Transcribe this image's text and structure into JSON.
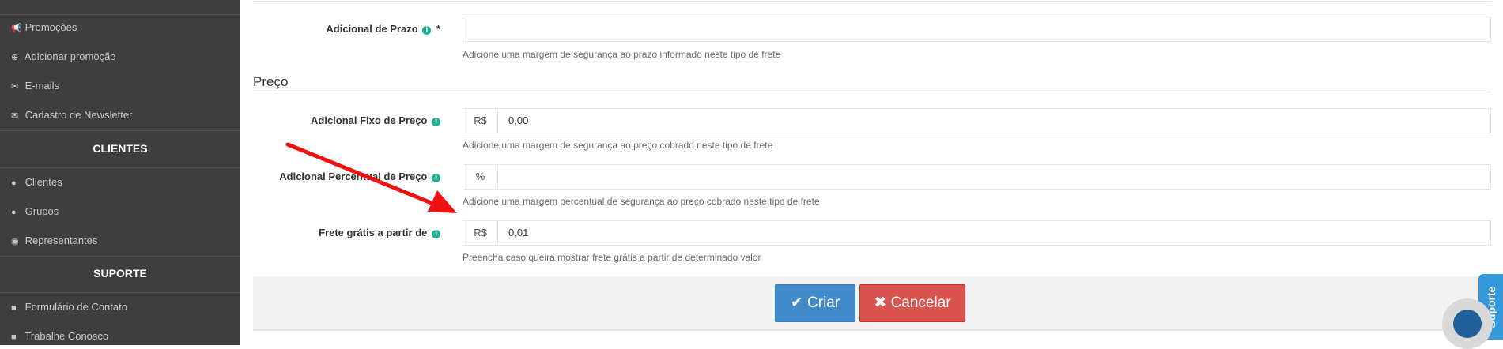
{
  "sidebar": {
    "items_marketing": [
      {
        "label": "Promoções",
        "icon": "megaphone-icon"
      },
      {
        "label": "Adicionar promoção",
        "icon": "plus-circle-icon"
      },
      {
        "label": "E-mails",
        "icon": "envelope-icon"
      },
      {
        "label": "Cadastro de Newsletter",
        "icon": "envelope-icon"
      }
    ],
    "section_clientes": "CLIENTES",
    "items_clientes": [
      {
        "label": "Clientes",
        "icon": "user-icon"
      },
      {
        "label": "Grupos",
        "icon": "users-icon"
      },
      {
        "label": "Representantes",
        "icon": "user-circle-icon"
      }
    ],
    "section_suporte": "SUPORTE",
    "items_suporte": [
      {
        "label": "Formulário de Contato",
        "icon": "comment-icon"
      },
      {
        "label": "Trabalhe Conosco",
        "icon": "briefcase-icon"
      }
    ]
  },
  "form": {
    "prazo_label": "Adicional de Prazo",
    "prazo_required": "*",
    "prazo_value": "",
    "prazo_help": "Adicione uma margem de segurança ao prazo informado neste tipo de frete",
    "preco_section": "Preço",
    "fixo_label": "Adicional Fixo de Preço",
    "fixo_addon": "R$",
    "fixo_value": "0,00",
    "fixo_help": "Adicione uma margem de segurança ao preço cobrado neste tipo de frete",
    "percentual_label": "Adicional Percentual de Preço",
    "percentual_addon": "%",
    "percentual_value": "",
    "percentual_help": "Adicione uma margem percentual de segurança ao preço cobrado neste tipo de frete",
    "frete_label": "Frete grátis a partir de",
    "frete_addon": "R$",
    "frete_value": "0,01",
    "frete_help": "Preencha caso queira mostrar frete grátis a partir de determinado valor"
  },
  "actions": {
    "create_label": "Criar",
    "cancel_label": "Cancelar"
  },
  "widgets": {
    "support_tab": "Suporte"
  },
  "colors": {
    "sidebar_bg": "#3e3e3e",
    "primary": "#428bca",
    "danger": "#d9534f",
    "info": "#1ab394",
    "annotation_arrow": "#ee1111"
  }
}
